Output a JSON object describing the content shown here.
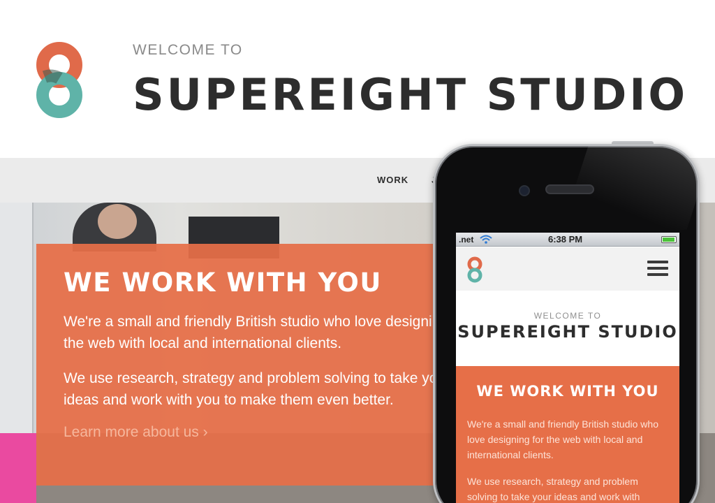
{
  "header": {
    "welcome": "WELCOME TO",
    "title": "SUPEREIGHT STUDIO"
  },
  "nav": {
    "items": [
      "WORK",
      "J"
    ]
  },
  "hero": {
    "title": "WE WORK WITH YOU",
    "paragraph1": "We're a small and friendly British studio who love designing for the web with local and international clients.",
    "paragraph2": "We use research, strategy and problem solving to take your ideas and work with you to make them even better.",
    "link": "Learn more about us ›"
  },
  "phone": {
    "status": {
      "carrier": ".net",
      "time": "6:38 PM"
    },
    "welcome": "WELCOME TO",
    "title": "SUPEREIGHT STUDIO",
    "hero_title": "WE WORK WITH YOU",
    "paragraph1": "We're a small and friendly British studio who love designing for the web with local and international clients.",
    "paragraph2": "We use research, strategy and problem solving to take your ideas and work with"
  },
  "colors": {
    "brand_orange": "#e66f48",
    "brand_teal": "#5fb3a8",
    "text_dark": "#2d2d2d"
  },
  "icons": [
    "logo-eight-icon",
    "wifi-icon",
    "battery-icon",
    "menu-icon"
  ]
}
